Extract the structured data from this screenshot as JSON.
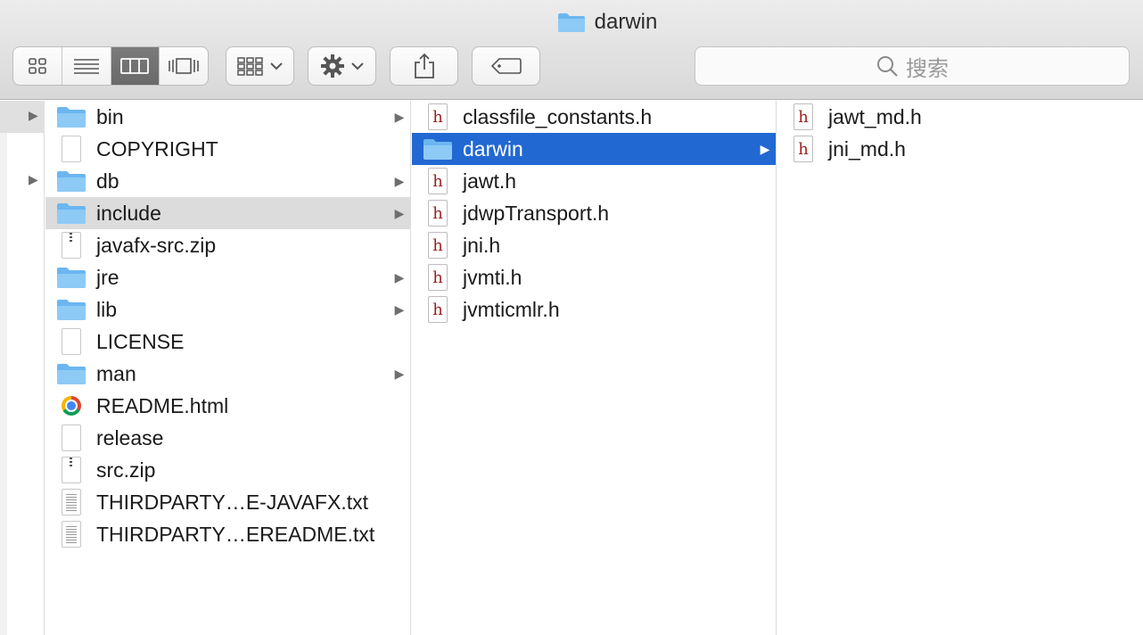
{
  "window": {
    "title": "darwin"
  },
  "toolbar": {
    "view_modes": [
      "icon-view-icon",
      "list-view-icon",
      "column-view-icon",
      "coverflow-view-icon"
    ],
    "active_view": "column-view-icon",
    "search_placeholder": "搜索"
  },
  "columns": {
    "col1": [
      {
        "label": "bin",
        "type": "folder",
        "expandable": true
      },
      {
        "label": "COPYRIGHT",
        "type": "file",
        "expandable": false
      },
      {
        "label": "db",
        "type": "folder",
        "expandable": true
      },
      {
        "label": "include",
        "type": "folder",
        "expandable": true
      },
      {
        "label": "javafx-src.zip",
        "type": "zip",
        "expandable": false
      },
      {
        "label": "jre",
        "type": "folder",
        "expandable": true
      },
      {
        "label": "lib",
        "type": "folder",
        "expandable": true
      },
      {
        "label": "LICENSE",
        "type": "file",
        "expandable": false
      },
      {
        "label": "man",
        "type": "folder",
        "expandable": true
      },
      {
        "label": "README.html",
        "type": "html",
        "expandable": false
      },
      {
        "label": "release",
        "type": "file",
        "expandable": false
      },
      {
        "label": "src.zip",
        "type": "zip",
        "expandable": false
      },
      {
        "label": "THIRDPARTY…E-JAVAFX.txt",
        "type": "text",
        "expandable": false
      },
      {
        "label": "THIRDPARTY…EREADME.txt",
        "type": "text",
        "expandable": false
      }
    ],
    "col2": [
      {
        "label": "classfile_constants.h",
        "type": "header",
        "expandable": false
      },
      {
        "label": "darwin",
        "type": "folder",
        "expandable": true
      },
      {
        "label": "jawt.h",
        "type": "header",
        "expandable": false
      },
      {
        "label": "jdwpTransport.h",
        "type": "header",
        "expandable": false
      },
      {
        "label": "jni.h",
        "type": "header",
        "expandable": false
      },
      {
        "label": "jvmti.h",
        "type": "header",
        "expandable": false
      },
      {
        "label": "jvmticmlr.h",
        "type": "header",
        "expandable": false
      }
    ],
    "col3": [
      {
        "label": "jawt_md.h",
        "type": "header",
        "expandable": false
      },
      {
        "label": "jni_md.h",
        "type": "header",
        "expandable": false
      }
    ]
  },
  "selection": {
    "col1": "include",
    "col2": "darwin"
  },
  "colors": {
    "selection": "#2268d3",
    "folder": "#6cb6f0",
    "inactive_selection": "#dcdcdc"
  }
}
